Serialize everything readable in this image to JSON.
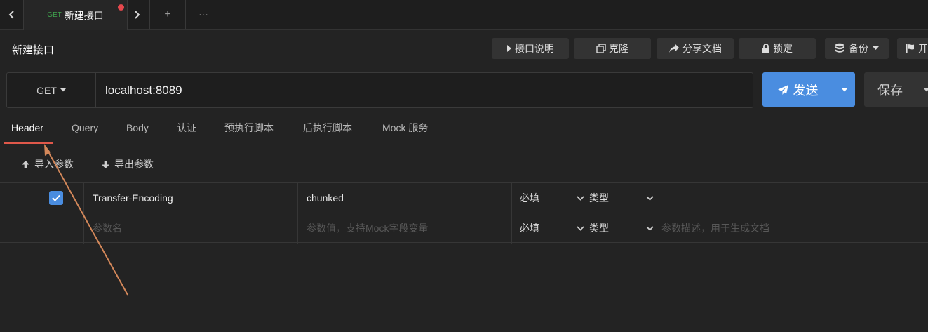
{
  "tabbar": {
    "active_tab": {
      "method": "GET",
      "title": "新建接口"
    },
    "add_label": "+",
    "more_label": "···"
  },
  "toolbar": {
    "page_title": "新建接口",
    "doc_label": "接口说明",
    "clone_label": "克隆",
    "share_label": "分享文档",
    "lock_label": "锁定",
    "backup_label": "备份",
    "open_label": "开"
  },
  "request": {
    "method": "GET",
    "url": "localhost:8089",
    "send_label": "发送",
    "save_label": "保存"
  },
  "subtabs": [
    "Header",
    "Query",
    "Body",
    "认证",
    "预执行脚本",
    "后执行脚本",
    "Mock 服务"
  ],
  "actions": {
    "import_label": "导入参数",
    "export_label": "导出参数"
  },
  "table": {
    "rows": [
      {
        "checked": true,
        "name": "Transfer-Encoding",
        "value": "chunked",
        "required": "必填",
        "type": "类型",
        "desc": ""
      }
    ],
    "new_row": {
      "name_placeholder": "参数名",
      "value_placeholder": "参数值，支持Mock字段变量",
      "required": "必填",
      "type": "类型",
      "desc_placeholder": "参数描述，用于生成文档"
    }
  },
  "colors": {
    "accent": "#4a8de0",
    "active_underline": "#e0584a",
    "annotation_arrow": "#d4885a",
    "method_green": "#3fa34d",
    "unsaved_dot": "#e5484d"
  }
}
